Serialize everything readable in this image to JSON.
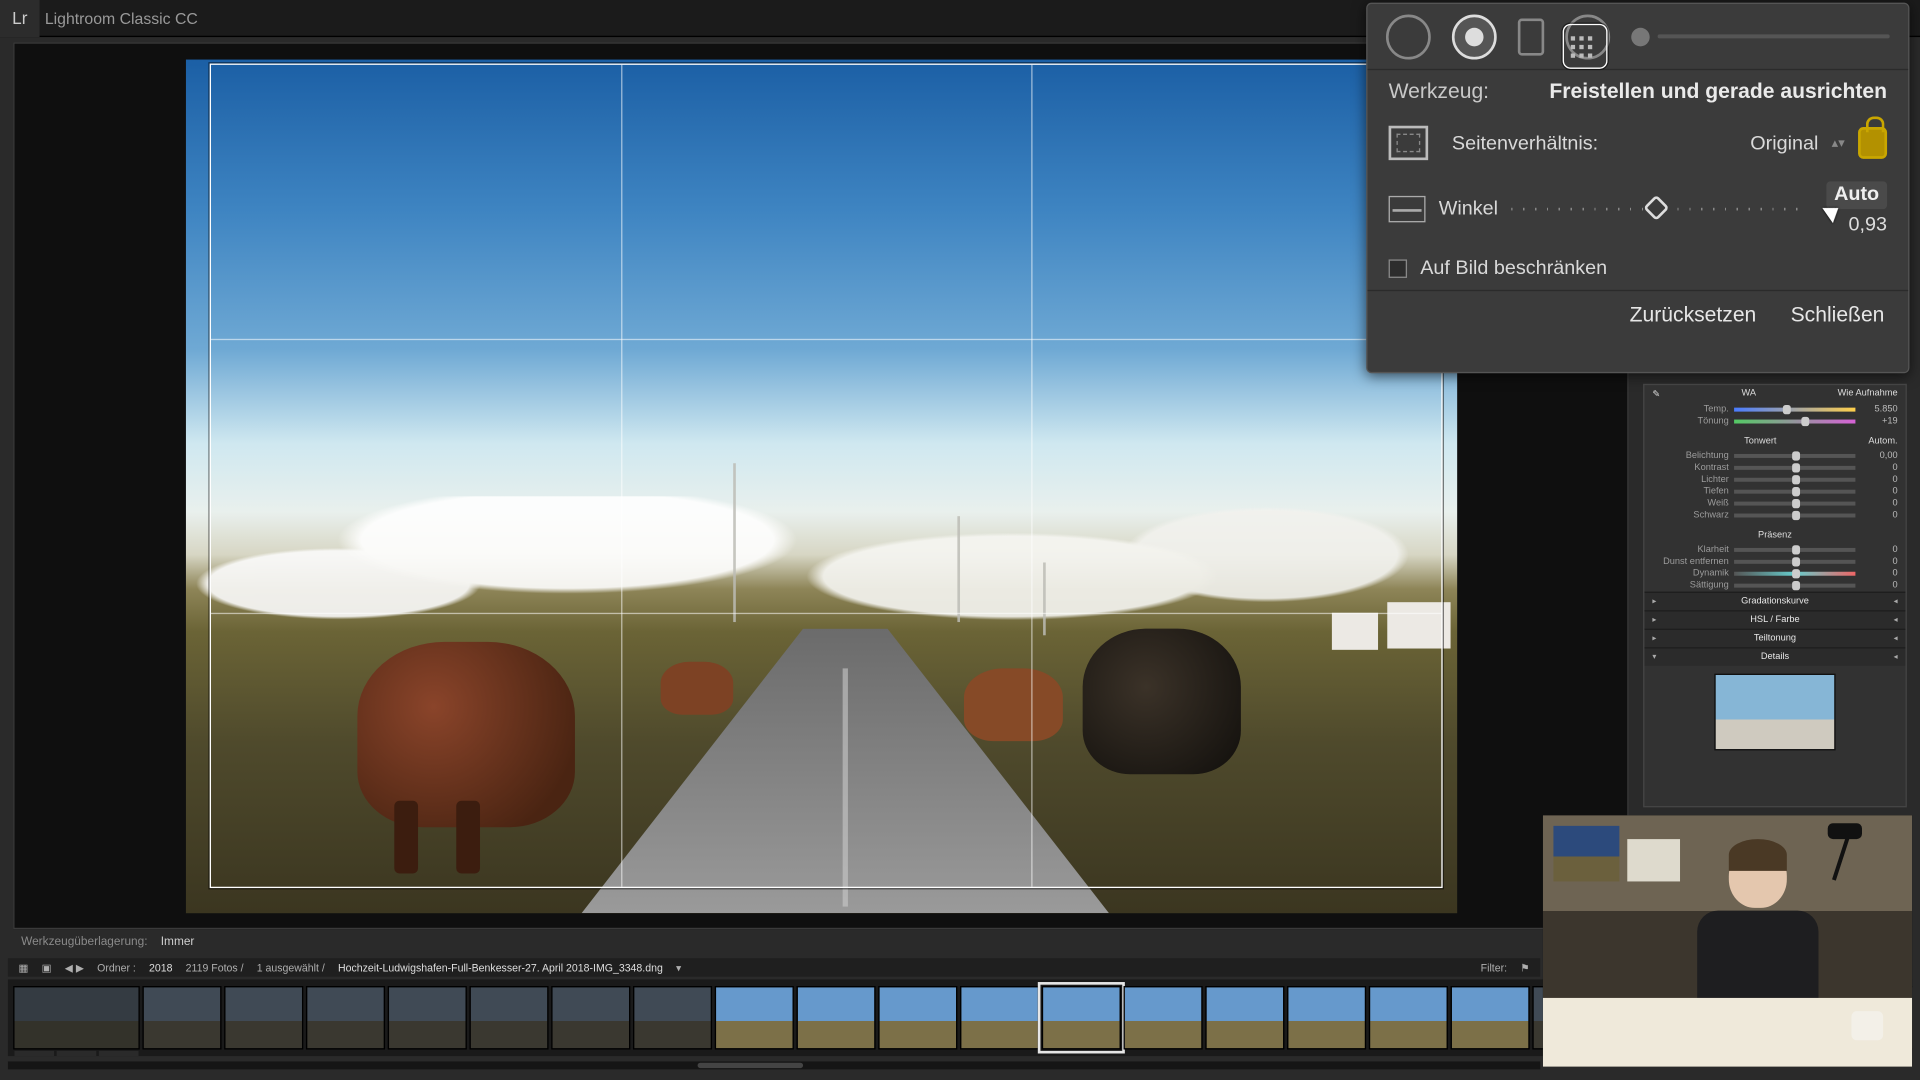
{
  "app": {
    "title": "Lightroom Classic CC",
    "logo": "Lr"
  },
  "crop_panel": {
    "tool_label": "Werkzeug:",
    "tool_name": "Freistellen und gerade ausrichten",
    "aspect_label": "Seitenverhältnis:",
    "aspect_value": "Original",
    "angle_label": "Winkel",
    "angle_auto": "Auto",
    "angle_value": "0,93",
    "constrain_label": "Auf Bild beschränken",
    "reset": "Zurücksetzen",
    "close": "Schließen"
  },
  "develop": {
    "wb_abbrev": "WA",
    "wb_value": "Wie Aufnahme",
    "temp": {
      "name": "Temp.",
      "value": "5.850"
    },
    "tint": {
      "name": "Tönung",
      "value": "+19"
    },
    "tone_title": "Tonwert",
    "tone_auto": "Autom.",
    "exposure": {
      "name": "Belichtung",
      "value": "0,00"
    },
    "contrast": {
      "name": "Kontrast",
      "value": "0"
    },
    "highlights": {
      "name": "Lichter",
      "value": "0"
    },
    "shadows": {
      "name": "Tiefen",
      "value": "0"
    },
    "whites": {
      "name": "Weiß",
      "value": "0"
    },
    "blacks": {
      "name": "Schwarz",
      "value": "0"
    },
    "presence_title": "Präsenz",
    "clarity": {
      "name": "Klarheit",
      "value": "0"
    },
    "dehaze": {
      "name": "Dunst entfernen",
      "value": "0"
    },
    "vibrance": {
      "name": "Dynamik",
      "value": "0"
    },
    "saturation": {
      "name": "Sättigung",
      "value": "0"
    },
    "sections": {
      "tone_curve": "Gradationskurve",
      "hsl": "HSL / Farbe",
      "split": "Teiltonung",
      "detail": "Details"
    }
  },
  "under_toolbar": {
    "overlay_label": "Werkzeugüberlagerung:",
    "overlay_value": "Immer"
  },
  "strip_header": {
    "folder_label": "Ordner :",
    "folder_value": "2018",
    "count": "2119 Fotos /",
    "selected": "1 ausgewählt /",
    "filename": "Hochzeit-Ludwigshafen-Full-Benkesser-27. April 2018-IMG_3348.dng",
    "filter_label": "Filter:"
  }
}
